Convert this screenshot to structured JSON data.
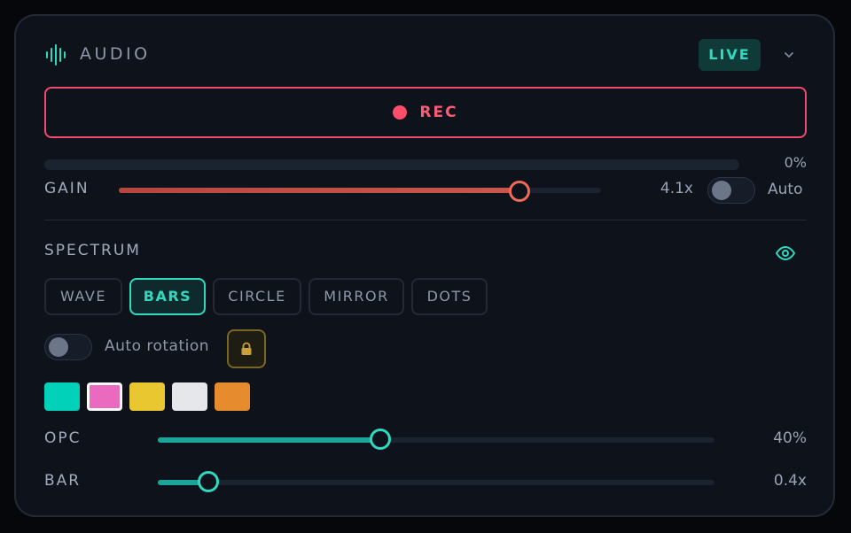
{
  "header": {
    "title": "AUDIO",
    "icon": "waveform-icon",
    "badge": "LIVE"
  },
  "record": {
    "label": "REC"
  },
  "level": {
    "value_label": "0%",
    "fraction": 0
  },
  "gain": {
    "label": "GAIN",
    "value_label": "4.1x",
    "fraction": 0.83,
    "auto_label": "Auto",
    "auto_enabled": false
  },
  "spectrum": {
    "title": "SPECTRUM",
    "modes": [
      {
        "label": "WAVE",
        "active": false
      },
      {
        "label": "BARS",
        "active": true
      },
      {
        "label": "CIRCLE",
        "active": false
      },
      {
        "label": "MIRROR",
        "active": false
      },
      {
        "label": "DOTS",
        "active": false
      }
    ],
    "auto_rotation_label": "Auto rotation",
    "auto_rotation_enabled": false,
    "swatches": [
      "#00d1b8",
      "#ea6ac0",
      "#e8c731",
      "#e6e7ea",
      "#e78b2f"
    ],
    "selected_swatch": 1
  },
  "opc": {
    "label": "OPC",
    "value_label": "40%",
    "fraction": 0.4
  },
  "bar": {
    "label": "BAR",
    "value_label": "0.4x",
    "fraction": 0.09
  },
  "colors": {
    "accent": "#2fd9c0",
    "record": "#ff4d6a",
    "gain": "#f06a55",
    "lock": "#c9a13a"
  }
}
